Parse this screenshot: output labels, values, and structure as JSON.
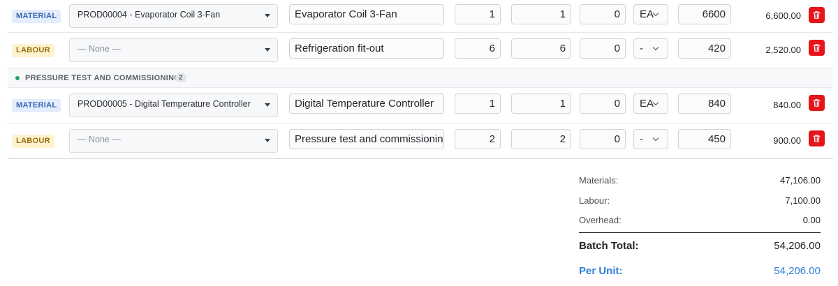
{
  "rows": [
    {
      "type": "MATERIAL",
      "product": "PROD00004 - Evaporator Coil 3-Fan",
      "description": "Evaporator Coil 3-Fan",
      "q1": "1",
      "q2": "1",
      "q3": "0",
      "uom": "EA",
      "rate": "6600",
      "amount": "6,600.00"
    },
    {
      "type": "LABOUR",
      "product": "— None —",
      "description": "Refrigeration fit-out",
      "q1": "6",
      "q2": "6",
      "q3": "0",
      "uom": "-",
      "rate": "420",
      "amount": "2,520.00"
    },
    {
      "type": "MATERIAL",
      "product": "PROD00005 - Digital Temperature Controller",
      "description": "Digital Temperature Controller",
      "q1": "1",
      "q2": "1",
      "q3": "0",
      "uom": "EA",
      "rate": "840",
      "amount": "840.00"
    },
    {
      "type": "LABOUR",
      "product": "— None —",
      "description": "Pressure test and commissioning",
      "q1": "2",
      "q2": "2",
      "q3": "0",
      "uom": "-",
      "rate": "450",
      "amount": "900.00"
    }
  ],
  "section": {
    "title": "PRESSURE TEST AND COMMISSIONING",
    "count": "2"
  },
  "totals": {
    "materials_label": "Materials:",
    "materials": "47,106.00",
    "labour_label": "Labour:",
    "labour": "7,100.00",
    "overhead_label": "Overhead:",
    "overhead": "0.00",
    "batch_total_label": "Batch Total:",
    "batch_total": "54,206.00",
    "per_unit_label": "Per Unit:",
    "per_unit": "54,206.00"
  },
  "colors": {
    "material_badge": "#e3edfb",
    "labour_badge": "#fdf3cf",
    "delete": "#e5151a",
    "accent": "#2f80d8",
    "section_dot": "#22a06b"
  }
}
